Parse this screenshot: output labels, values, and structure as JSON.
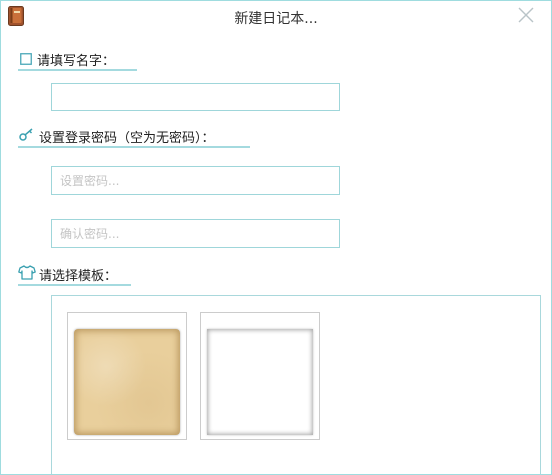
{
  "window": {
    "title": "新建日记本...",
    "accent_color": "#9fdcdf"
  },
  "name_section": {
    "label": "请填写名字：",
    "icon": "square-outline-icon",
    "input_value": "",
    "input_placeholder": ""
  },
  "password_section": {
    "label": "设置登录密码（空为无密码）：",
    "icon": "key-icon",
    "password_placeholder": "设置密码...",
    "confirm_placeholder": "确认密码..."
  },
  "template_section": {
    "label": "请选择模板：",
    "icon": "shirt-icon",
    "templates": [
      {
        "name": "paper-texture",
        "color": "#e9cf9c"
      },
      {
        "name": "blank-white",
        "color": "#ffffff"
      }
    ]
  }
}
